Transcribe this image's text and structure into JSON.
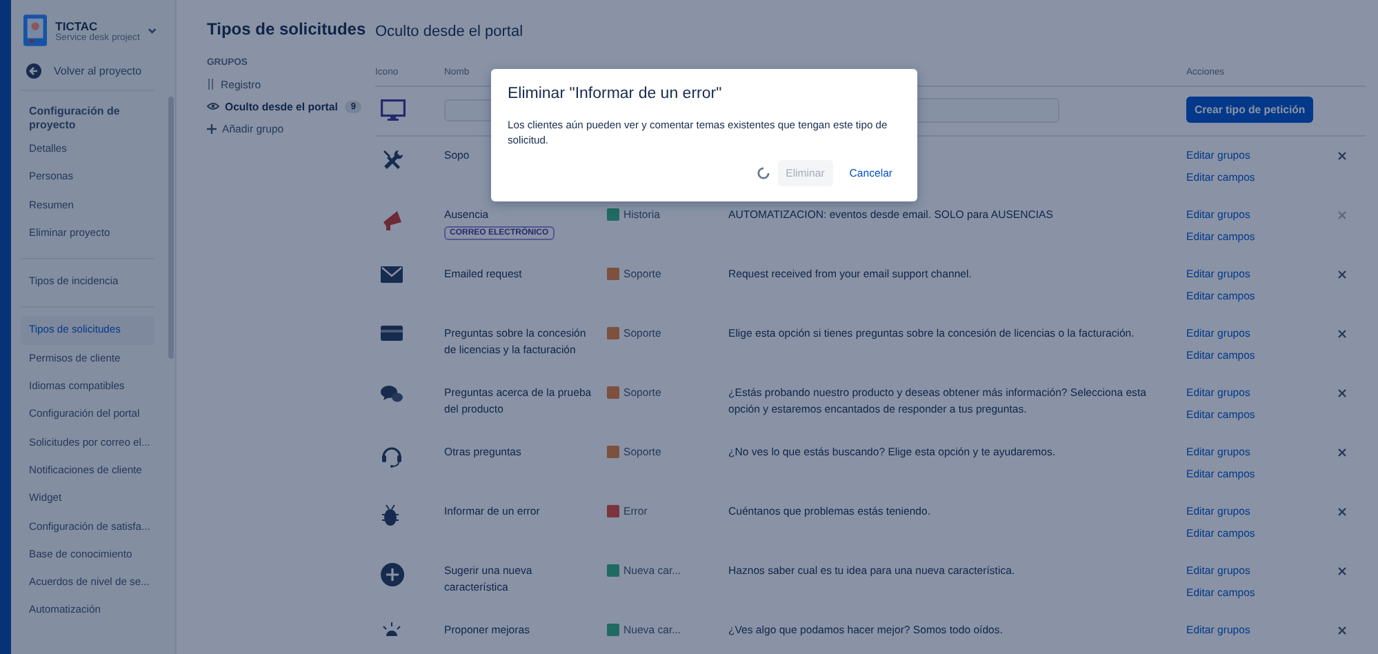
{
  "sidebar": {
    "project": {
      "name": "TICTAC",
      "type": "Service desk project"
    },
    "back_link": "Volver al proyecto",
    "sections": [
      {
        "heading": "Configuración de proyecto",
        "items": [
          {
            "label": "Detalles",
            "selected": false
          },
          {
            "label": "Personas",
            "selected": false
          },
          {
            "label": "Resumen",
            "selected": false
          },
          {
            "label": "Eliminar proyecto",
            "selected": false
          }
        ]
      },
      {
        "items": [
          {
            "label": "Tipos de incidencia",
            "selected": false
          }
        ]
      },
      {
        "items": [
          {
            "label": "Tipos de solicitudes",
            "selected": true
          },
          {
            "label": "Permisos de cliente",
            "selected": false
          },
          {
            "label": "Idiomas compatibles",
            "selected": false
          },
          {
            "label": "Configuración del portal",
            "selected": false
          },
          {
            "label": "Solicitudes por correo el...",
            "selected": false
          },
          {
            "label": "Notificaciones de cliente",
            "selected": false
          },
          {
            "label": "Widget",
            "selected": false
          },
          {
            "label": "Configuración de satisfa...",
            "selected": false
          },
          {
            "label": "Base de conocimiento",
            "selected": false
          },
          {
            "label": "Acuerdos de nivel de se...",
            "selected": false
          },
          {
            "label": "Automatización",
            "selected": false
          }
        ]
      }
    ]
  },
  "page_title": "Tipos de solicitudes",
  "groups": {
    "heading": "GRUPOS",
    "items": [
      {
        "label": "Registro",
        "kind": "drag",
        "selected": false
      },
      {
        "label": "Oculto desde el portal",
        "kind": "hidden",
        "count": "9",
        "selected": true
      }
    ],
    "add_label": "Añadir grupo"
  },
  "group_title": "Oculto desde el portal",
  "table": {
    "columns": {
      "icon": "Icono",
      "name": "Nomb",
      "actions": "Acciones"
    },
    "create_button": "Crear tipo de petición",
    "rows": [
      {
        "kind": "tools",
        "name": "Sopo",
        "actions": [
          "Editar grupos",
          "Editar campos"
        ],
        "deletable": true
      },
      {
        "kind": "megaphone",
        "name": "Ausencia",
        "tag": "CORREO ELECTRÓNICO",
        "type": {
          "kind": "story",
          "label": "Historia"
        },
        "description": "AUTOMATIZACION: eventos desde email. SOLO para AUSENCIAS",
        "actions": [
          "Editar grupos",
          "Editar campos"
        ],
        "deletable": false
      },
      {
        "kind": "mail",
        "name": "Emailed request",
        "type": {
          "kind": "support",
          "label": "Soporte"
        },
        "description": "Request received from your email support channel.",
        "actions": [
          "Editar grupos",
          "Editar campos"
        ],
        "deletable": true
      },
      {
        "kind": "card",
        "name": "Preguntas sobre la concesión de licencias y la facturación",
        "type": {
          "kind": "support",
          "label": "Soporte"
        },
        "description": "Elige esta opción si tienes preguntas sobre la concesión de licencias o la facturación.",
        "actions": [
          "Editar grupos",
          "Editar campos"
        ],
        "deletable": true
      },
      {
        "kind": "chat",
        "name": "Preguntas acerca de la prueba del producto",
        "type": {
          "kind": "support",
          "label": "Soporte"
        },
        "description": "¿Estás probando nuestro producto y deseas obtener más información? Selecciona esta opción y estaremos encantados de responder a tus preguntas.",
        "actions": [
          "Editar grupos",
          "Editar campos"
        ],
        "deletable": true
      },
      {
        "kind": "headset",
        "name": "Otras preguntas",
        "type": {
          "kind": "support",
          "label": "Soporte"
        },
        "description": "¿No ves lo que estás buscando? Elige esta opción y te ayudaremos.",
        "actions": [
          "Editar grupos",
          "Editar campos"
        ],
        "deletable": true
      },
      {
        "kind": "bug",
        "name": "Informar de un error",
        "type": {
          "kind": "bug",
          "label": "Error"
        },
        "description": "Cuéntanos que problemas estás teniendo.",
        "actions": [
          "Editar grupos",
          "Editar campos"
        ],
        "deletable": true
      },
      {
        "kind": "plus",
        "name": "Sugerir una nueva característica",
        "type": {
          "kind": "feature",
          "label": "Nueva car..."
        },
        "description": "Haznos saber cual es tu idea para una nueva característica.",
        "actions": [
          "Editar grupos",
          "Editar campos"
        ],
        "deletable": true
      },
      {
        "kind": "bulb",
        "name": "Proponer mejoras",
        "type": {
          "kind": "feature",
          "label": "Nueva car..."
        },
        "description": "¿Ves algo que podamos hacer mejor? Somos todo oídos.",
        "actions": [
          "Editar grupos"
        ],
        "deletable": true
      }
    ]
  },
  "modal": {
    "title": "Eliminar \"Informar de un error\"",
    "message": "Los clientes aún pueden ver y comentar temas existentes que tengan este tipo de solicitud.",
    "busy": true,
    "buttons": [
      {
        "label": "Eliminar",
        "kind": "primary",
        "disabled": true
      },
      {
        "label": "Cancelar",
        "kind": "link",
        "disabled": false
      }
    ]
  }
}
